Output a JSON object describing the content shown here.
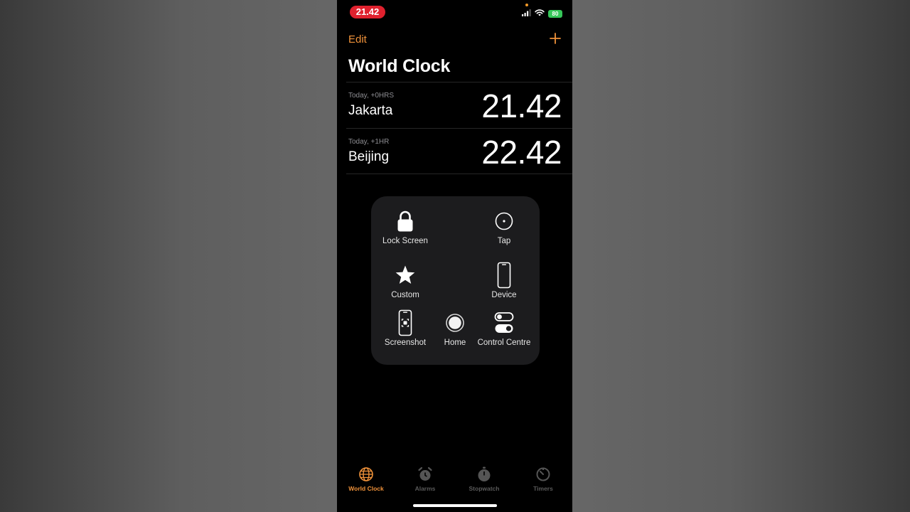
{
  "status_bar": {
    "time": "21.42",
    "battery": "80",
    "icons": [
      "signal-icon",
      "wifi-icon",
      "battery-icon"
    ],
    "time_pill_color": "#e0212e",
    "battery_color": "#36c759"
  },
  "nav": {
    "edit_label": "Edit",
    "add_icon": "plus-icon",
    "accent_color": "#f0923a"
  },
  "page_title": "World Clock",
  "clocks": [
    {
      "offset": "Today, +0HRS",
      "city": "Jakarta",
      "time": "21.42"
    },
    {
      "offset": "Today, +1HR",
      "city": "Beijing",
      "time": "22.42"
    }
  ],
  "assistive_touch": {
    "items": [
      {
        "label": "Lock Screen",
        "icon": "lock-icon"
      },
      {
        "label": "Tap",
        "icon": "tap-icon"
      },
      {
        "label": "Custom",
        "icon": "star-icon"
      },
      {
        "label": "Device",
        "icon": "device-icon"
      },
      {
        "label": "Screenshot",
        "icon": "screenshot-icon"
      },
      {
        "label": "Home",
        "icon": "home-button-icon"
      },
      {
        "label": "Control Centre",
        "icon": "control-centre-icon"
      }
    ]
  },
  "tabs": [
    {
      "label": "World Clock",
      "icon": "globe-icon",
      "active": true
    },
    {
      "label": "Alarms",
      "icon": "alarm-clock-icon",
      "active": false
    },
    {
      "label": "Stopwatch",
      "icon": "stopwatch-icon",
      "active": false
    },
    {
      "label": "Timers",
      "icon": "timer-icon",
      "active": false
    }
  ]
}
